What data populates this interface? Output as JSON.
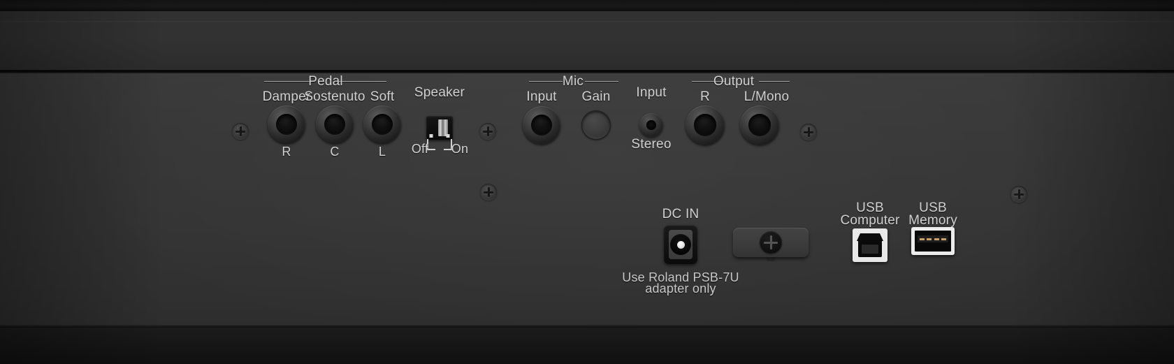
{
  "device": {
    "panel_name": "digital-piano-rear-connector-panel",
    "surface_color": "#353535",
    "label_color": "#d2d2d2"
  },
  "groups": {
    "pedal": {
      "title": "Pedal"
    },
    "mic": {
      "title": "Mic"
    },
    "output": {
      "title": "Output"
    }
  },
  "pedal": {
    "jacks": [
      {
        "label": "Damper",
        "sublabel": "R"
      },
      {
        "label": "Sostenuto",
        "sublabel": "C"
      },
      {
        "label": "Soft",
        "sublabel": "L"
      }
    ]
  },
  "speaker": {
    "label": "Speaker",
    "off_label": "Off",
    "on_label": "On",
    "position": "On"
  },
  "mic": {
    "input_label": "Input",
    "gain_label": "Gain"
  },
  "aux": {
    "input_label": "Input",
    "stereo_label": "Stereo"
  },
  "output": {
    "r_label": "R",
    "l_mono_label": "L/Mono"
  },
  "power": {
    "dc_in_label": "DC IN",
    "caption_line1": "Use Roland PSB-7U",
    "caption_line2": "adapter only"
  },
  "usb": {
    "computer": {
      "line1": "USB",
      "line2": "Computer",
      "connector": "usb-type-b"
    },
    "memory": {
      "line1": "USB",
      "line2": "Memory",
      "connector": "usb-type-a"
    }
  },
  "screws": {
    "icon": "phillips-screw-icon",
    "count": 6
  }
}
